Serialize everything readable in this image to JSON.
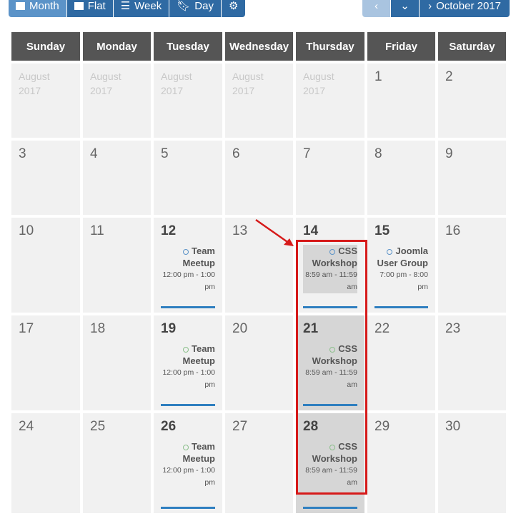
{
  "toolbar": {
    "views": [
      {
        "label": "Month",
        "icon": "calendar-icon",
        "active": true
      },
      {
        "label": "Flat",
        "icon": "book-icon",
        "active": false
      },
      {
        "label": "Week",
        "icon": "list-icon",
        "active": false
      },
      {
        "label": "Day",
        "icon": "bookmark-icon",
        "active": false
      }
    ],
    "settings_icon": "gear-icon"
  },
  "nav": {
    "prev_icon": "chevron-left-icon",
    "down_icon": "chevron-down-icon",
    "next_label": "October 2017",
    "next_icon": "chevron-right-icon"
  },
  "weekdays": [
    "Sunday",
    "Monday",
    "Tuesday",
    "Wednesday",
    "Thursday",
    "Friday",
    "Saturday"
  ],
  "other_month_label": "August 2017",
  "days": {
    "d1": "1",
    "d2": "2",
    "d3": "3",
    "d4": "4",
    "d5": "5",
    "d6": "6",
    "d7": "7",
    "d8": "8",
    "d9": "9",
    "d10": "10",
    "d11": "11",
    "d12": "12",
    "d13": "13",
    "d14": "14",
    "d15": "15",
    "d16": "16",
    "d17": "17",
    "d18": "18",
    "d19": "19",
    "d20": "20",
    "d21": "21",
    "d22": "22",
    "d23": "23",
    "d24": "24",
    "d25": "25",
    "d26": "26",
    "d27": "27",
    "d28": "28",
    "d29": "29",
    "d30": "30"
  },
  "events": {
    "e12": {
      "title": "Team Meetup",
      "time": "12:00 pm - 1:00 pm"
    },
    "e14": {
      "title": "CSS Workshop",
      "time": "8:59 am - 11:59 am"
    },
    "e15": {
      "title": "Joomla User Group",
      "time": "7:00 pm - 8:00 pm"
    },
    "e19": {
      "title": "Team Meetup",
      "time": "12:00 pm - 1:00 pm"
    },
    "e21": {
      "title": "CSS Workshop",
      "time": "8:59 am - 11:59 am"
    },
    "e26": {
      "title": "Team Meetup",
      "time": "12:00 pm - 1:00 pm"
    },
    "e28": {
      "title": "CSS Workshop",
      "time": "8:59 am - 11:59 am"
    }
  },
  "colors": {
    "header_bg": "#555555",
    "button": "#2f6aa3",
    "highlight": "#d61a1a",
    "event_bar": "#2f7fc0"
  }
}
